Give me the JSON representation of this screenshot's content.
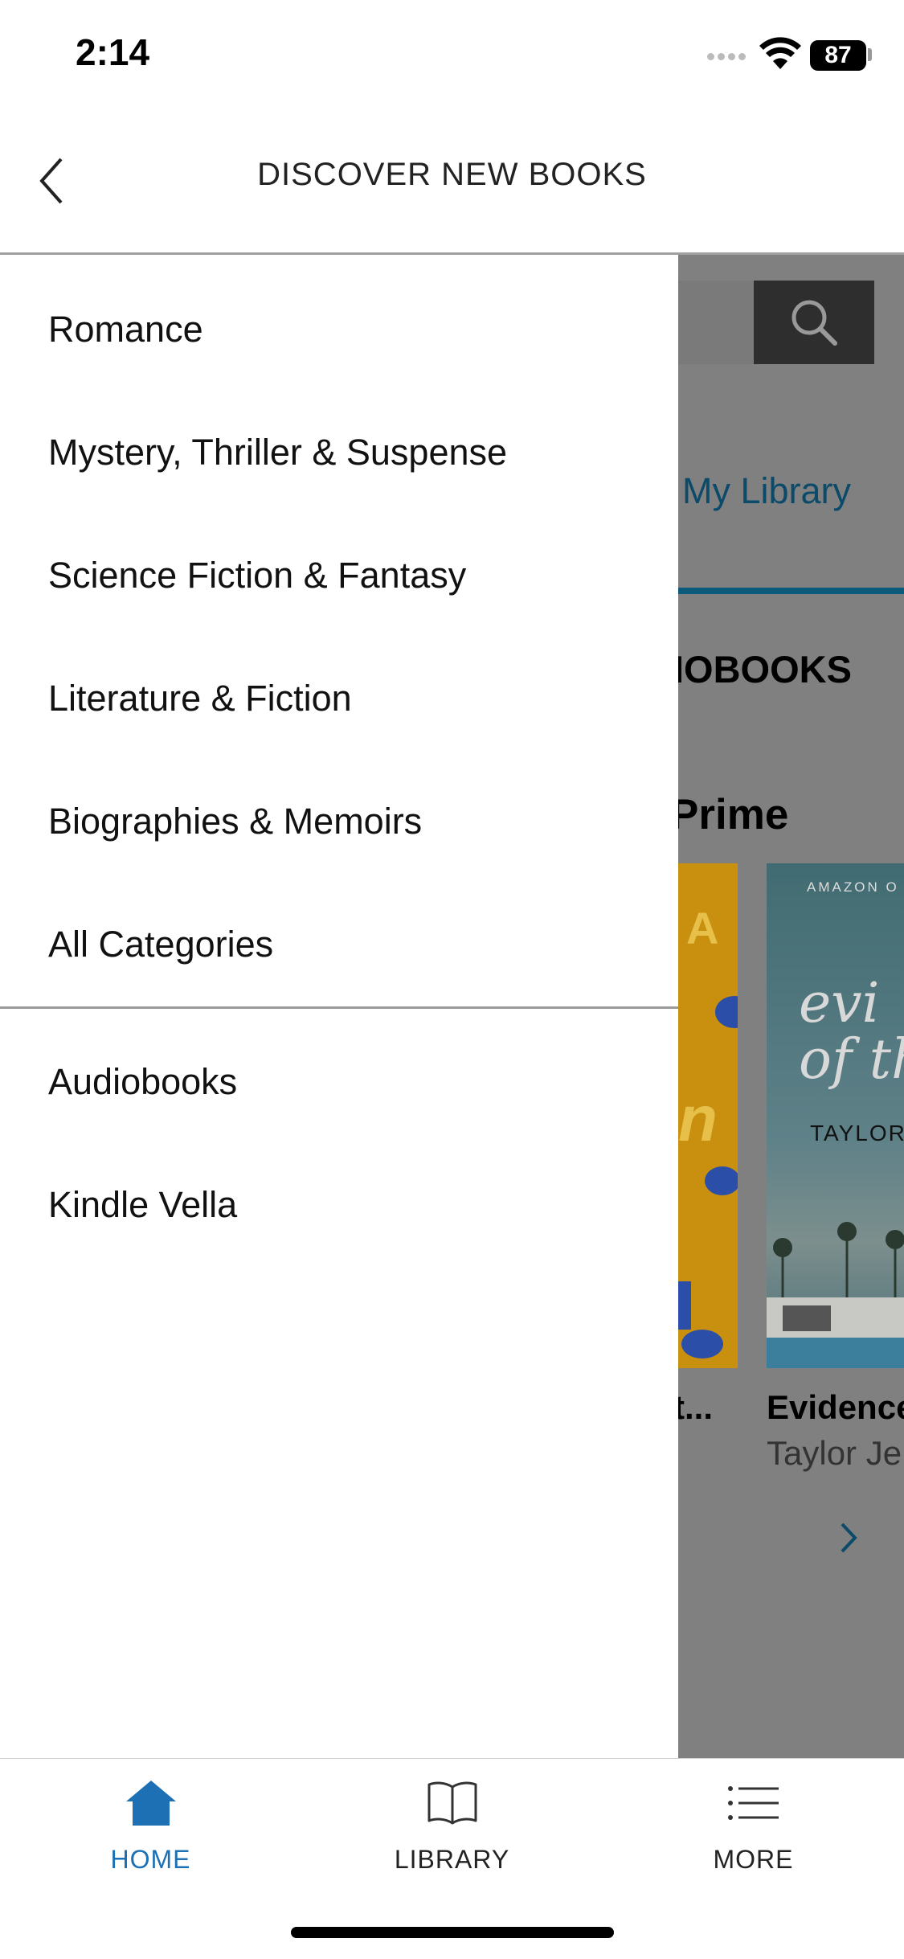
{
  "status_bar": {
    "time": "2:14",
    "battery": "87"
  },
  "header": {
    "title": "DISCOVER NEW BOOKS"
  },
  "drawer": {
    "categories": [
      "Romance",
      "Mystery, Thriller & Suspense",
      "Science Fiction & Fantasy",
      "Literature & Fiction",
      "Biographies & Memoirs",
      "All Categories"
    ],
    "extras": [
      "Audiobooks",
      "Kindle Vella"
    ]
  },
  "background": {
    "tab_text": "y My Library",
    "audiobooks_tab": "IOBOOKS",
    "section_title": "Prime",
    "cover2_publisher": "AMAZON O",
    "cover2_title_line1": "evi",
    "cover2_title_line2": "of th",
    "cover2_author": "TAYLOR J",
    "book1_title": "t...",
    "book2_title": "Evidence",
    "book2_author": "Taylor Je"
  },
  "tabbar": {
    "home": "HOME",
    "library": "LIBRARY",
    "more": "MORE",
    "active_color": "#1c70b3"
  },
  "colors": {
    "overlay": "#808080",
    "accent": "#1c70b3"
  }
}
